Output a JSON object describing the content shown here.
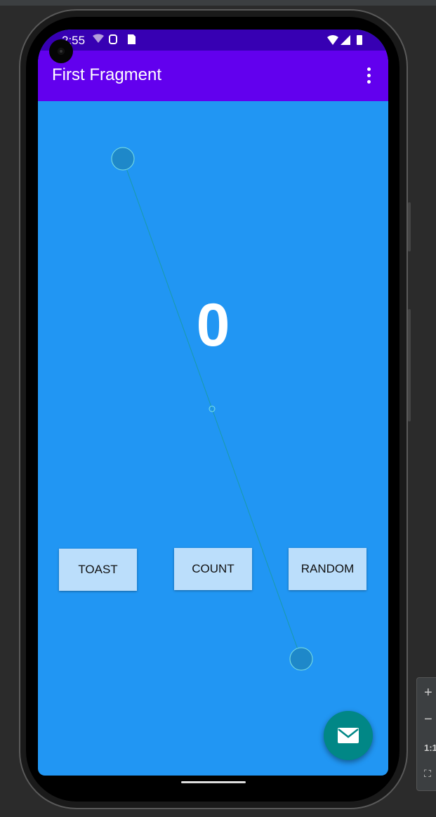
{
  "status_bar": {
    "time": "2:55",
    "left_icons": "wifi-question, shield, sd-card",
    "right_icons": "wifi, signal, battery"
  },
  "app_bar": {
    "title": "First Fragment"
  },
  "main": {
    "count": "0",
    "buttons": {
      "toast": "TOAST",
      "count": "COUNT",
      "random": "RANDOM"
    }
  },
  "fab": {
    "icon": "email-icon"
  },
  "zoom_controls": {
    "zoom_in": "+",
    "zoom_out": "−",
    "actual_size": "1:1"
  },
  "colors": {
    "background": "#2196f3",
    "app_bar": "#6200ee",
    "status_bar": "#3700b3",
    "button": "#bbdefb",
    "fab": "#018786"
  }
}
